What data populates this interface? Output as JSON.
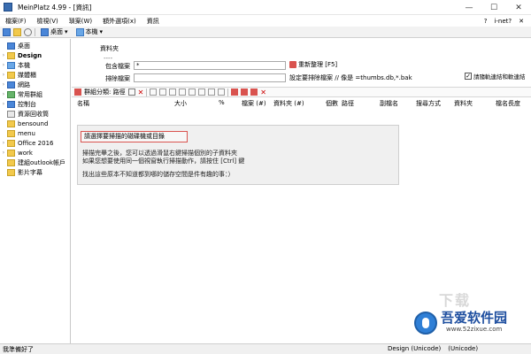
{
  "window": {
    "title": "MeinPlatz 4.99 - [資訊]",
    "controls": {
      "minimize": "—",
      "maximize": "☐",
      "close": "✕"
    }
  },
  "menubar": {
    "items": [
      "檔案(F)",
      "檢視(V)",
      "瑣案(W)",
      "額外選項(x)",
      "資訊"
    ],
    "right": {
      "help": "?",
      "inet": "i-net?",
      "close": "✕"
    }
  },
  "toolbar": {
    "location_label": "桌面",
    "view_label": "本機"
  },
  "tree": {
    "items": [
      {
        "label": "桌面",
        "icon": "desktop-folder-icon",
        "expand": "",
        "bold": false
      },
      {
        "label": "Design",
        "icon": "folder-icon",
        "expand": "›",
        "bold": true
      },
      {
        "label": "本機",
        "icon": "computer-icon",
        "expand": "›",
        "bold": false
      },
      {
        "label": "媒體櫃",
        "icon": "library-icon",
        "expand": "›",
        "bold": false
      },
      {
        "label": "網路",
        "icon": "network-icon",
        "expand": "›",
        "bold": false
      },
      {
        "label": "常用群組",
        "icon": "homegroup-icon",
        "expand": "›",
        "bold": false
      },
      {
        "label": "控制台",
        "icon": "control-panel-icon",
        "expand": "›",
        "bold": false
      },
      {
        "label": "資源回收筒",
        "icon": "recycle-bin-icon",
        "expand": "",
        "bold": false
      },
      {
        "label": "bensound",
        "icon": "folder-icon",
        "expand": "",
        "bold": false
      },
      {
        "label": "menu",
        "icon": "folder-icon",
        "expand": "",
        "bold": false
      },
      {
        "label": "Office 2016",
        "icon": "folder-icon",
        "expand": "›",
        "bold": false
      },
      {
        "label": "work",
        "icon": "folder-icon",
        "expand": "›",
        "bold": false
      },
      {
        "label": "建組outlook帳戶",
        "icon": "folder-icon",
        "expand": "",
        "bold": false
      },
      {
        "label": "影片字幕",
        "icon": "folder-icon",
        "expand": "",
        "bold": false
      }
    ]
  },
  "main": {
    "section_title": "資料夾",
    "section_dash": "----",
    "include_label": "包含檔案",
    "include_value": "*",
    "exclude_label": "排除檔案",
    "exclude_value": "",
    "refresh_label": "重新整理 [F5]",
    "exclude_hint": "設定要排除檔案 // 像是 =thumbs.db,*.bak",
    "follow_links_label": "請隨軌連結和軟連結",
    "follow_links_checked": true,
    "subtoolbar": {
      "group_label": "群組分類: 路徑"
    },
    "columns": [
      "名稱",
      "大小",
      "%",
      "檔案 (#)",
      "資料夾 (#)",
      "個數",
      "路徑",
      "副檔名",
      "搜尋方式",
      "資料夾",
      "檔名長度"
    ],
    "message": {
      "title": "請選擇要掃描的磁碟機或目錄",
      "line1": "掃描完畢之後，您可以透過滑鼠右鍵掃描個別的子資料夾",
      "line2": "如果您想要使用同一個視窗執行掃描動作，請按住 [Ctrl] 鍵",
      "line3": "找出這些原本不知道都到哪的儲存空間是件有趣的事：）"
    }
  },
  "statusbar": {
    "left": "我準備好了",
    "encoding": "Design (Unicode)",
    "encoding2": "(Unicode)"
  },
  "watermark": {
    "big": "吾爱软件园",
    "small": "www.52zixue.com",
    "faint": "下载"
  },
  "colors": {
    "highlight_border": "#d9534f",
    "brand_blue": "#1f4fa0"
  }
}
